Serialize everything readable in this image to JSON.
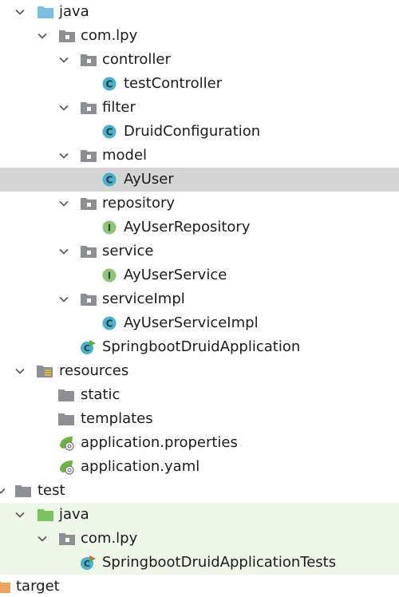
{
  "tree": [
    {
      "label": "java",
      "icon": "folder-blue-icon",
      "expanded": true
    },
    {
      "label": "com.lpy",
      "icon": "package-icon",
      "expanded": true
    },
    {
      "label": "controller",
      "icon": "package-icon",
      "expanded": true
    },
    {
      "label": "testController",
      "icon": "class-icon"
    },
    {
      "label": "filter",
      "icon": "package-icon",
      "expanded": true
    },
    {
      "label": "DruidConfiguration",
      "icon": "class-icon"
    },
    {
      "label": "model",
      "icon": "package-icon",
      "expanded": true
    },
    {
      "label": "AyUser",
      "icon": "class-icon",
      "selected": true
    },
    {
      "label": "repository",
      "icon": "package-icon",
      "expanded": true
    },
    {
      "label": "AyUserRepository",
      "icon": "interface-icon"
    },
    {
      "label": "service",
      "icon": "package-icon",
      "expanded": true
    },
    {
      "label": "AyUserService",
      "icon": "interface-icon"
    },
    {
      "label": "serviceImpl",
      "icon": "package-icon",
      "expanded": true
    },
    {
      "label": "AyUserServiceImpl",
      "icon": "class-icon"
    },
    {
      "label": "SpringbootDruidApplication",
      "icon": "spring-boot-class-icon"
    },
    {
      "label": "resources",
      "icon": "resources-folder-icon",
      "expanded": true
    },
    {
      "label": "static",
      "icon": "folder-gray-icon"
    },
    {
      "label": "templates",
      "icon": "folder-gray-icon"
    },
    {
      "label": "application.properties",
      "icon": "spring-config-icon"
    },
    {
      "label": "application.yaml",
      "icon": "spring-config-icon"
    },
    {
      "label": "test",
      "icon": "folder-gray-icon",
      "expanded": true
    },
    {
      "label": "java",
      "icon": "folder-green-icon",
      "expanded": true
    },
    {
      "label": "com.lpy",
      "icon": "package-icon",
      "expanded": true
    },
    {
      "label": "SpringbootDruidApplicationTests",
      "icon": "spring-boot-test-class-icon"
    },
    {
      "label": "target",
      "icon": "folder-orange-icon"
    }
  ],
  "colors": {
    "selected_row": "#d5d5d5",
    "test_rows": "#eef7e8",
    "class_icon": "#4bb0c9",
    "interface_icon": "#8fc47a",
    "folder_blue": "#7dbfe0",
    "folder_gray": "#8c8f93",
    "folder_green": "#7cc15f",
    "folder_orange": "#f0a15a"
  }
}
